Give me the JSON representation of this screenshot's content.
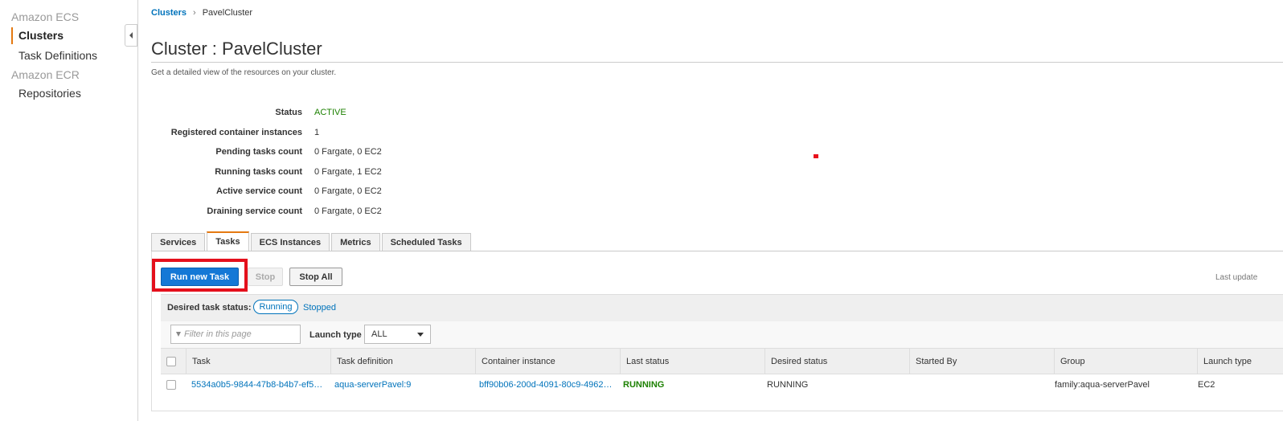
{
  "sidebar": {
    "sections": [
      {
        "title": "Amazon ECS",
        "items": [
          "Clusters",
          "Task Definitions"
        ]
      },
      {
        "title": "Amazon ECR",
        "items": [
          "Repositories"
        ]
      }
    ],
    "active_item": "Clusters"
  },
  "breadcrumb": {
    "root": "Clusters",
    "separator": "›",
    "current": "PavelCluster"
  },
  "page": {
    "title": "Cluster : PavelCluster",
    "subtitle": "Get a detailed view of the resources on your cluster."
  },
  "summary": [
    {
      "label": "Status",
      "value": "ACTIVE"
    },
    {
      "label": "Registered container instances",
      "value": "1"
    },
    {
      "label": "Pending tasks count",
      "value": "0 Fargate, 0 EC2"
    },
    {
      "label": "Running tasks count",
      "value": "0 Fargate, 1 EC2"
    },
    {
      "label": "Active service count",
      "value": "0 Fargate, 0 EC2"
    },
    {
      "label": "Draining service count",
      "value": "0 Fargate, 0 EC2"
    }
  ],
  "tabs": [
    "Services",
    "Tasks",
    "ECS Instances",
    "Metrics",
    "Scheduled Tasks"
  ],
  "active_tab": "Tasks",
  "toolbar": {
    "run_new_task": "Run new Task",
    "stop": "Stop",
    "stop_all": "Stop All",
    "last_update": "Last update"
  },
  "desired_status": {
    "label": "Desired task status:",
    "running": "Running",
    "stopped": "Stopped"
  },
  "filter": {
    "placeholder": "Filter in this page",
    "launch_type_label": "Launch type",
    "launch_type_value": "ALL"
  },
  "table": {
    "columns": [
      "Task",
      "Task definition",
      "Container instance",
      "Last status",
      "Desired status",
      "Started By",
      "Group",
      "Launch type"
    ],
    "rows": [
      {
        "task": "5534a0b5-9844-47b8-b4b7-ef5…",
        "task_definition": "aqua-serverPavel:9",
        "container_instance": "bff90b06-200d-4091-80c9-4962…",
        "last_status": "RUNNING",
        "desired_status": "RUNNING",
        "started_by": "",
        "group": "family:aqua-serverPavel",
        "launch_type": "EC2"
      }
    ]
  },
  "colors": {
    "accent": "#e47911",
    "link": "#0073bb",
    "primary": "#1478d6",
    "active_green": "#1d8102",
    "highlight_red": "#e4101c"
  }
}
